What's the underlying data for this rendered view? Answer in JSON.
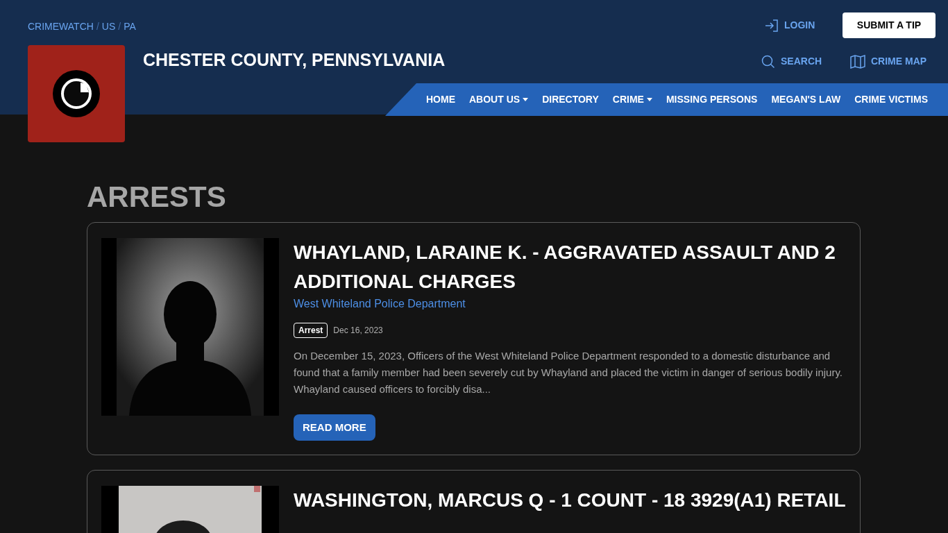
{
  "breadcrumb": [
    "CRIMEWATCH",
    "US",
    "PA"
  ],
  "breadcrumb_separator": "/",
  "site_title": "CHESTER COUNTY, PENNSYLVANIA",
  "login": "LOGIN",
  "submit_tip": "SUBMIT A TIP",
  "search": "SEARCH",
  "crime_map": "CRIME MAP",
  "nav": [
    {
      "label": "HOME",
      "dropdown": false
    },
    {
      "label": "ABOUT US",
      "dropdown": true
    },
    {
      "label": "DIRECTORY",
      "dropdown": false
    },
    {
      "label": "CRIME",
      "dropdown": true
    },
    {
      "label": "MISSING PERSONS",
      "dropdown": false
    },
    {
      "label": "MEGAN'S LAW",
      "dropdown": false
    },
    {
      "label": "CRIME VICTIMS",
      "dropdown": false
    }
  ],
  "heading": "ARRESTS",
  "posts": [
    {
      "title": "WHAYLAND, LARAINE K. - AGGRAVATED ASSAULT AND 2 ADDITIONAL CHARGES",
      "department": "West Whiteland Police Department",
      "tag": "Arrest",
      "date": "Dec 16, 2023",
      "excerpt": "On December 15, 2023, Officers of the West Whiteland Police Department responded to a domestic disturbance and found that a family member had been severely cut by Whayland and placed the victim in danger of serious bodily injury.  Whayland caused officers to forcibly disa...",
      "button": "READ MORE"
    },
    {
      "title": "WASHINGTON, MARCUS Q - 1 COUNT - 18 3929(A1) RETAIL"
    }
  ]
}
